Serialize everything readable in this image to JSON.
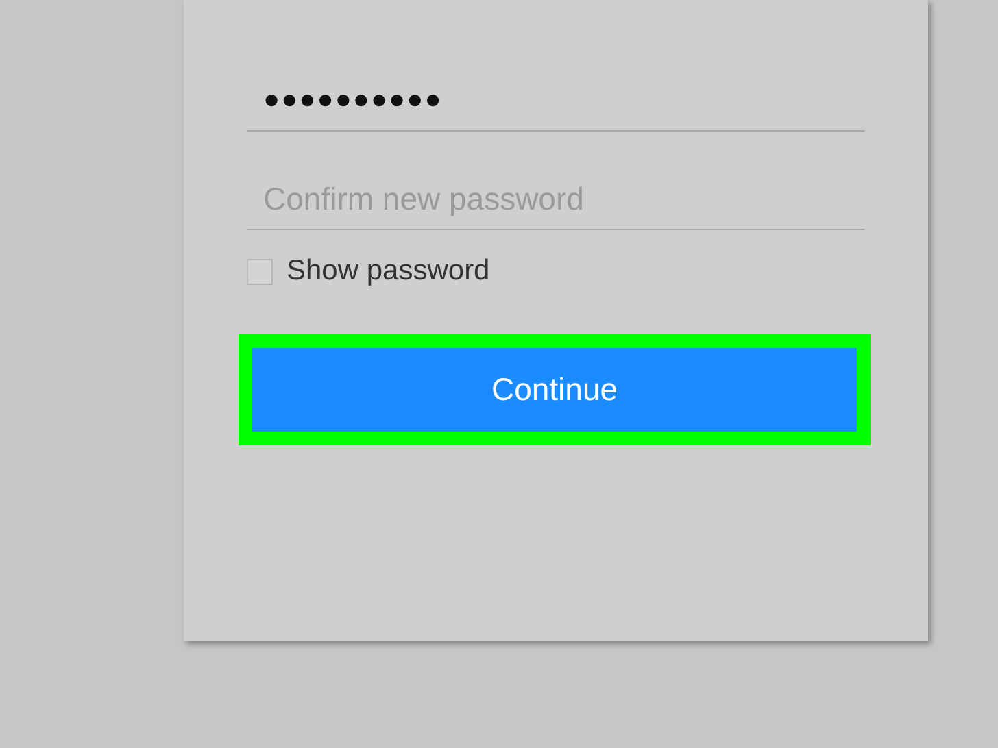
{
  "form": {
    "password": {
      "value": "●●●●●●●●●●"
    },
    "confirm_password": {
      "placeholder": "Confirm new password"
    },
    "show_password": {
      "label": "Show password",
      "checked": false
    },
    "continue_button": {
      "label": "Continue",
      "highlighted": true
    }
  }
}
